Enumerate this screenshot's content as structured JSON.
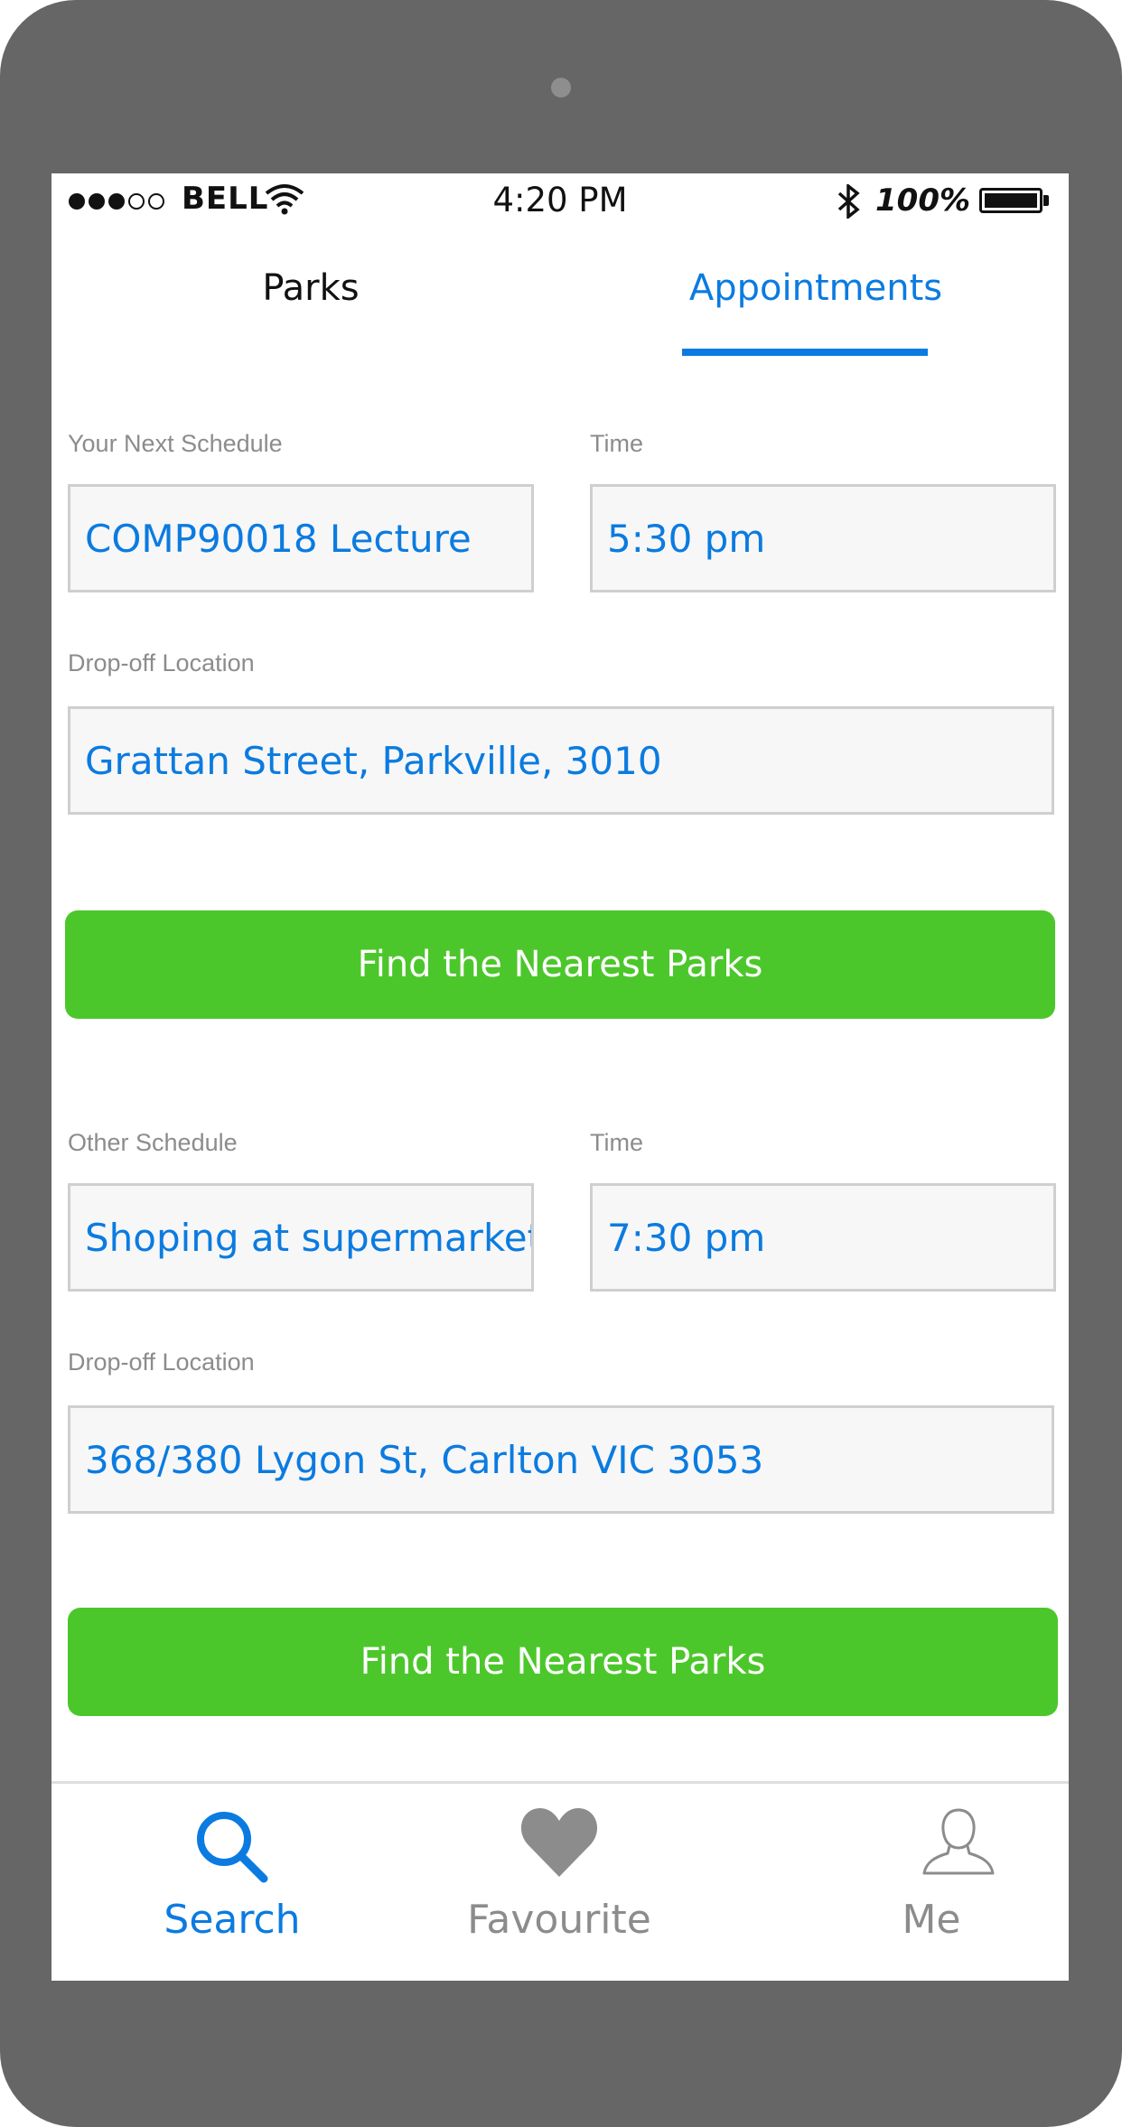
{
  "status_bar": {
    "carrier": "BELL",
    "time": "4:20 PM",
    "battery": "100%"
  },
  "tabs": [
    {
      "label": "Parks",
      "active": false
    },
    {
      "label": "Appointments",
      "active": true
    }
  ],
  "next_schedule": {
    "schedule_label": "Your Next Schedule",
    "schedule_value": "COMP90018 Lecture",
    "time_label": "Time",
    "time_value": "5:30 pm",
    "location_label": "Drop-off Location",
    "location_value": "Grattan Street, Parkville, 3010",
    "button_label": "Find the Nearest Parks"
  },
  "other_schedule": {
    "schedule_label": "Other Schedule",
    "schedule_value": "Shoping at supermarket",
    "time_label": "Time",
    "time_value": "7:30 pm",
    "location_label": "Drop-off Location",
    "location_value": "368/380 Lygon St, Carlton VIC 3053",
    "button_label": "Find the Nearest Parks"
  },
  "bottom_nav": [
    {
      "label": "Search",
      "icon": "search-icon",
      "active": true
    },
    {
      "label": "Favourite",
      "icon": "heart-icon",
      "active": false
    },
    {
      "label": "Me",
      "icon": "user-icon",
      "active": false
    }
  ],
  "colors": {
    "accent": "#0b7be0",
    "button": "#4cc72b",
    "inactive": "#8c8c8c",
    "frame": "#666666"
  }
}
